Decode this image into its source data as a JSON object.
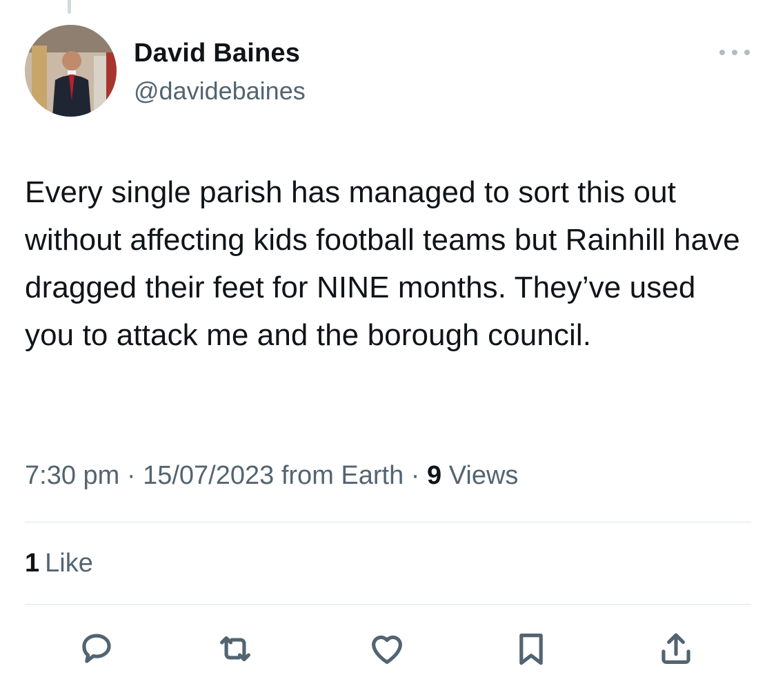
{
  "tweet": {
    "author": {
      "display_name": "David Baines",
      "handle": "@davidebaines"
    },
    "text": "Every single parish has managed to sort this out without affecting kids football teams but Rainhill have dragged their feet for NINE months. They’ve used you to attack me and the borough council.",
    "meta": {
      "time": "7:30 pm",
      "separator": "·",
      "date": "15/07/2023",
      "source": "from Earth",
      "views_count": "9",
      "views_label": "Views"
    },
    "engagement": {
      "likes_count": "1",
      "likes_label": "Like"
    }
  },
  "icons": {
    "more": "more-horizontal-icon",
    "reply": "reply-bubble-icon",
    "retweet": "retweet-icon",
    "like": "heart-icon",
    "bookmark": "bookmark-icon",
    "share": "share-upload-icon"
  },
  "colors": {
    "text_primary": "#0f1419",
    "text_secondary": "#536471",
    "divider": "#e1e6ea",
    "icon": "#536471"
  }
}
